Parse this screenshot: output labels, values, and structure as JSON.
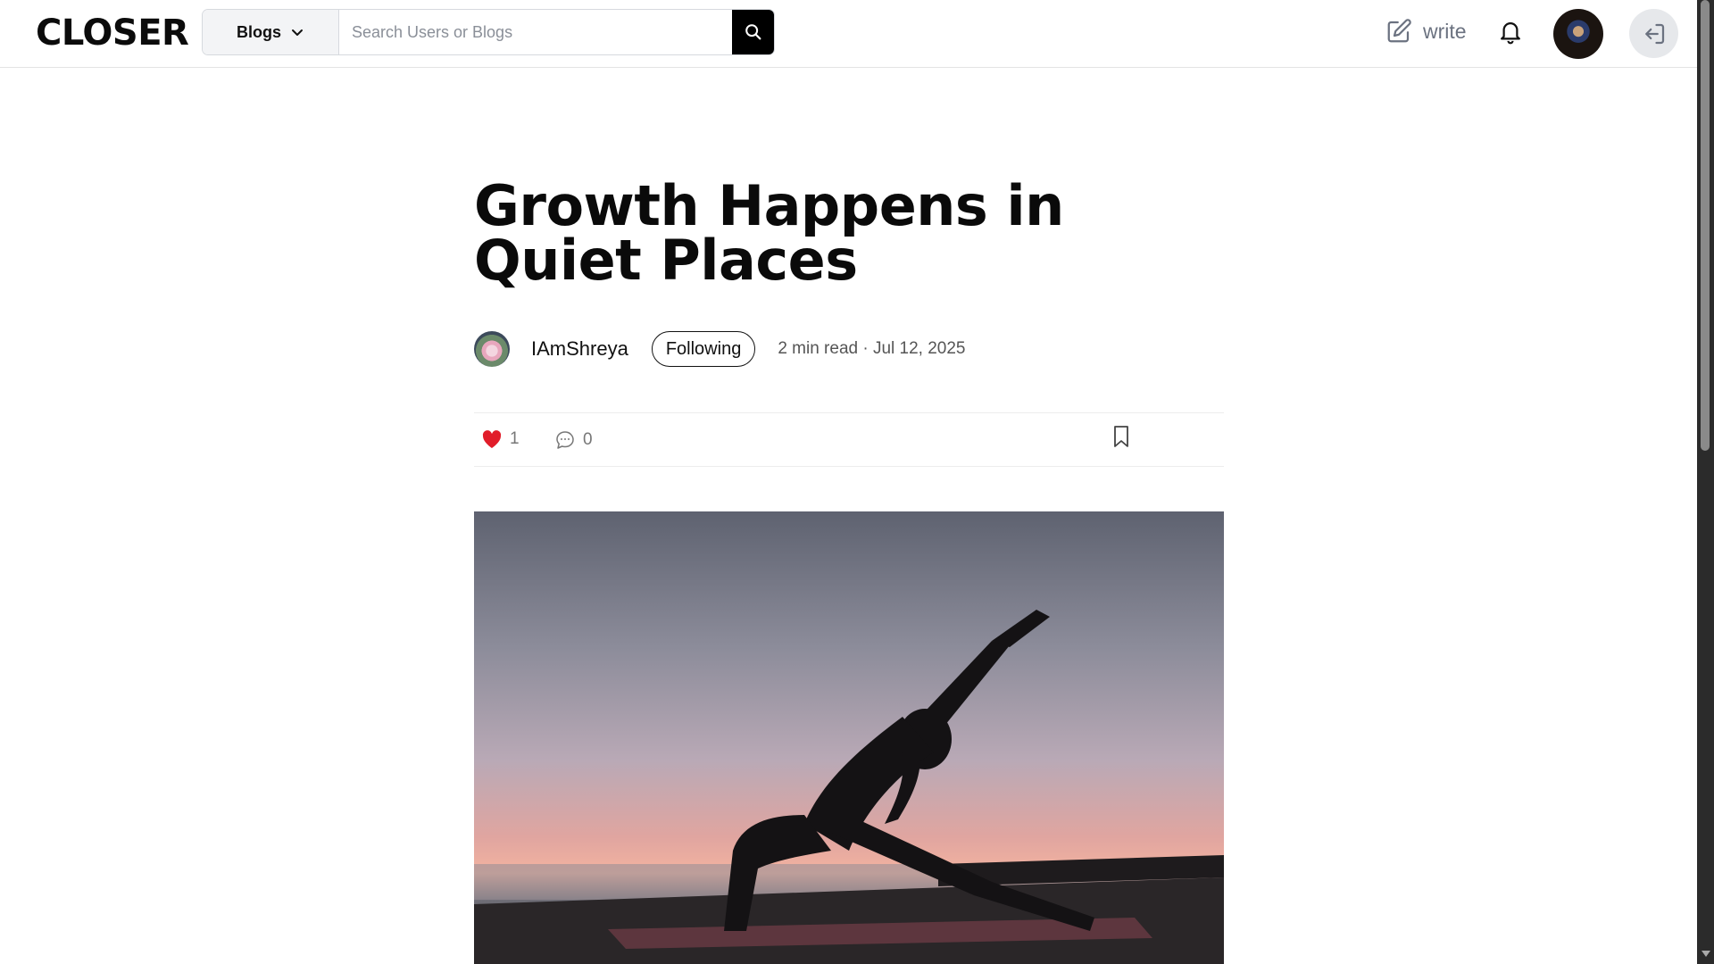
{
  "header": {
    "logo": "CLOSER",
    "search_scope": "Blogs",
    "search_placeholder": "Search Users or Blogs",
    "write_label": "write"
  },
  "article": {
    "title": "Growth Happens in Quiet Places",
    "author": "IAmShreya",
    "follow_label": "Following",
    "meta": "2 min read · Jul 12, 2025",
    "likes": "1",
    "comments": "0"
  },
  "colors": {
    "accent": "#000000",
    "like": "#e11d2a"
  }
}
